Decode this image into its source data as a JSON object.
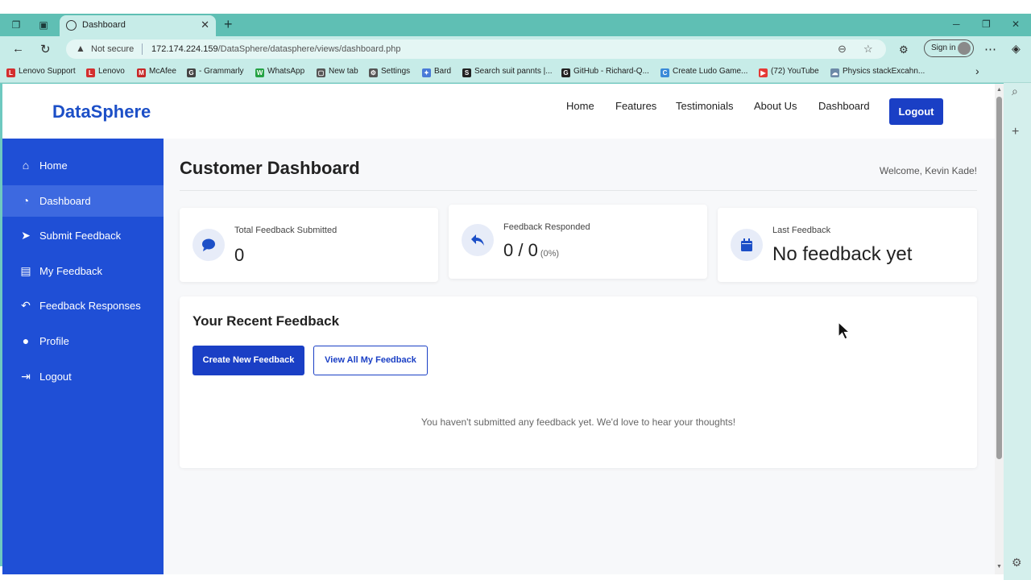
{
  "browser": {
    "tab_title": "Dashboard",
    "security_label": "Not secure",
    "url_host": "172.174.224.159",
    "url_path": "/DataSphere/datasphere/views/dashboard.php",
    "signin_label": "Sign in",
    "bookmarks": [
      {
        "label": "Lenovo Support",
        "icon": "L",
        "color": "#d32f2f"
      },
      {
        "label": "Lenovo",
        "icon": "L",
        "color": "#d32f2f"
      },
      {
        "label": "McAfee",
        "icon": "M",
        "color": "#c62828"
      },
      {
        "label": "- Grammarly",
        "icon": "G",
        "color": "#444444"
      },
      {
        "label": "WhatsApp",
        "icon": "W",
        "color": "#25a244"
      },
      {
        "label": "New tab",
        "icon": "▢",
        "color": "#555555"
      },
      {
        "label": "Settings",
        "icon": "⚙",
        "color": "#555555"
      },
      {
        "label": "Bard",
        "icon": "✦",
        "color": "#4a7bd8"
      },
      {
        "label": "Search suit pannts |...",
        "icon": "S",
        "color": "#222222"
      },
      {
        "label": "GitHub - Richard-Q...",
        "icon": "G",
        "color": "#222222"
      },
      {
        "label": "Create Ludo Game...",
        "icon": "C",
        "color": "#3a8ad8"
      },
      {
        "label": "(72) YouTube",
        "icon": "▶",
        "color": "#e53935"
      },
      {
        "label": "Physics stackExcahn...",
        "icon": "☁",
        "color": "#6d8aa8"
      }
    ]
  },
  "site": {
    "brand": "DataSphere",
    "nav": [
      "Home",
      "Features",
      "Testimonials",
      "About Us",
      "Dashboard"
    ],
    "logout_label": "Logout"
  },
  "sidebar": {
    "items": [
      {
        "label": "Home",
        "icon": "home-icon"
      },
      {
        "label": "Dashboard",
        "icon": "dashboard-icon",
        "active": true
      },
      {
        "label": "Submit Feedback",
        "icon": "paper-plane-icon"
      },
      {
        "label": "My Feedback",
        "icon": "clipboard-icon"
      },
      {
        "label": "Feedback Responses",
        "icon": "reply-all-icon"
      },
      {
        "label": "Profile",
        "icon": "user-icon"
      },
      {
        "label": "Logout",
        "icon": "sign-out-icon"
      }
    ]
  },
  "dashboard": {
    "title": "Customer Dashboard",
    "welcome": "Welcome, Kevin Kade!",
    "cards": [
      {
        "label": "Total Feedback Submitted",
        "value": "0",
        "icon": "comment-icon"
      },
      {
        "label": "Feedback Responded",
        "value": "0 / 0",
        "percent": "(0%)",
        "icon": "reply-icon"
      },
      {
        "label": "Last Feedback",
        "value": "No feedback yet",
        "icon": "calendar-icon"
      }
    ],
    "recent_title": "Your Recent Feedback",
    "create_label": "Create New Feedback",
    "view_all_label": "View All My Feedback",
    "empty_message": "You haven't submitted any feedback yet. We'd love to hear your thoughts!"
  },
  "colors": {
    "brand_blue": "#1c4fc7",
    "sidebar_blue": "#1f4fd6",
    "browser_teal": "#6ec9c0"
  }
}
